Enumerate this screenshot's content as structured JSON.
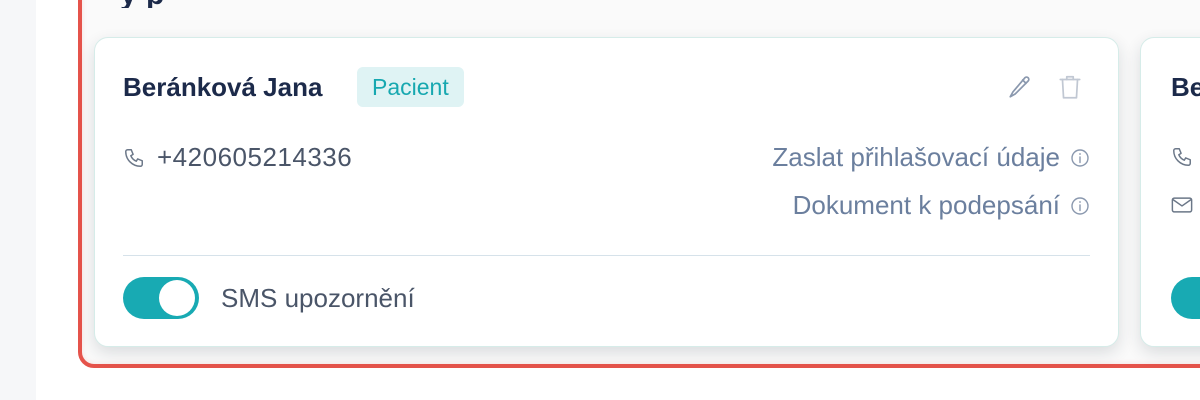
{
  "section": {
    "title_partial": "y p"
  },
  "contact": {
    "name": "Beránková Jana",
    "role_badge": "Pacient",
    "phone": "+420605214336",
    "actions": {
      "send_credentials": "Zaslat přihlašovací údaje",
      "document_to_sign": "Dokument k podepsání"
    },
    "sms_toggle": {
      "label": "SMS upozornění",
      "enabled": true
    }
  },
  "next_contact": {
    "name_partial": "Be"
  },
  "colors": {
    "accent": "#18aab3",
    "badge_bg": "#dff3f4",
    "highlight_border": "#e5534b",
    "name_text": "#1c2a4a",
    "link_text": "#6b7f9e"
  },
  "icons": [
    "pencil-icon",
    "trash-icon",
    "phone-icon",
    "info-icon",
    "mail-icon"
  ]
}
